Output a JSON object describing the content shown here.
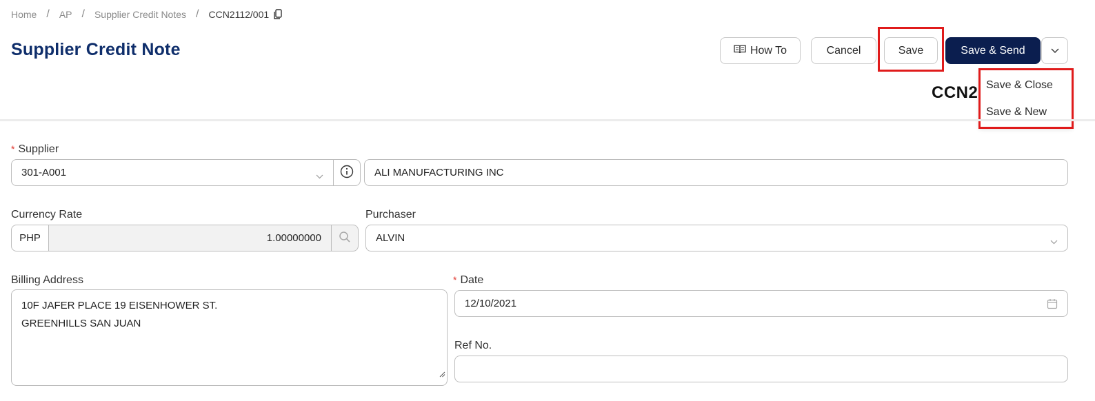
{
  "breadcrumb": {
    "items": [
      "Home",
      "AP",
      "Supplier Credit Notes"
    ],
    "current": "CCN2112/001",
    "separator": "/"
  },
  "page": {
    "title": "Supplier Credit Note",
    "doc_number": "CCN2112/001"
  },
  "toolbar": {
    "howto_label": "How To",
    "cancel_label": "Cancel",
    "save_label": "Save",
    "save_send_label": "Save & Send"
  },
  "save_menu": {
    "items": [
      "Save & Close",
      "Save & New"
    ]
  },
  "form": {
    "supplier": {
      "label": "Supplier",
      "required_mark": "*",
      "code": "301-A001",
      "name": "ALI MANUFACTURING INC"
    },
    "currency": {
      "label": "Currency Rate",
      "code": "PHP",
      "rate": "1.00000000"
    },
    "purchaser": {
      "label": "Purchaser",
      "value": "ALVIN"
    },
    "billing": {
      "label": "Billing Address",
      "line1": "10F JAFER PLACE 19 EISENHOWER ST.",
      "line2": "GREENHILLS SAN JUAN"
    },
    "date": {
      "label": "Date",
      "required_mark": "*",
      "value": "12/10/2021"
    },
    "ref": {
      "label": "Ref No.",
      "value": ""
    }
  },
  "colors": {
    "title": "#0f2e6b",
    "primary_button": "#0b1e4f",
    "highlight": "#e01b1b",
    "required": "#e0342b"
  }
}
